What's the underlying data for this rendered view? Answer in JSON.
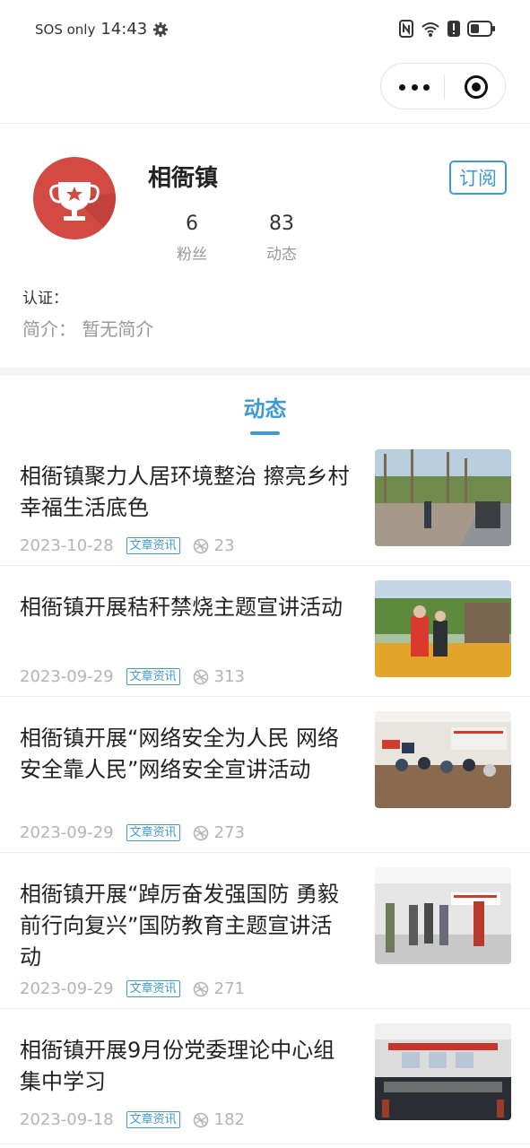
{
  "status_bar": {
    "carrier": "SOS only",
    "time": "14:43"
  },
  "profile": {
    "name": "相衙镇",
    "subscribe_label": "订阅",
    "stats": [
      {
        "value": "6",
        "label": "粉丝"
      },
      {
        "value": "83",
        "label": "动态"
      }
    ],
    "certification": "认证：",
    "intro": "简介：  暂无简介"
  },
  "tab": {
    "label": "动态"
  },
  "articles": [
    {
      "title": "相衙镇聚力人居环境整治  擦亮乡村幸福生活底色",
      "date": "2023-10-28",
      "tag": "文章资讯",
      "views": "23"
    },
    {
      "title": "相衙镇开展秸秆禁烧主题宣讲活动",
      "date": "2023-09-29",
      "tag": "文章资讯",
      "views": "313"
    },
    {
      "title": "相衙镇开展“网络安全为人民 网络安全靠人民”网络安全宣讲活动",
      "date": "2023-09-29",
      "tag": "文章资讯",
      "views": "273"
    },
    {
      "title": "相衙镇开展“踔厉奋发强国防 勇毅前行向复兴”国防教育主题宣讲活动",
      "date": "2023-09-29",
      "tag": "文章资讯",
      "views": "271"
    },
    {
      "title": "相衙镇开展9月份党委理论中心组集中学习",
      "date": "2023-09-18",
      "tag": "文章资讯",
      "views": "182"
    }
  ]
}
